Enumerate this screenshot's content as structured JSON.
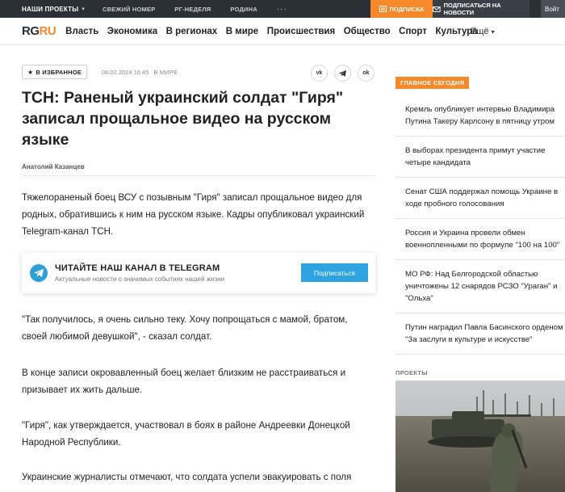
{
  "topbar": {
    "projects": "НАШИ ПРОЕКТЫ",
    "links": [
      "СВЕЖИЙ НОМЕР",
      "РГ-НЕДЕЛЯ",
      "РОДИНА"
    ],
    "more_dots": "···",
    "subscribe": "ПОДПИСКА",
    "news_subscribe": "ПОДПИСАТЬСЯ НА НОВОСТИ",
    "login": "Войт"
  },
  "navbar": {
    "logo_rg": "RG",
    "logo_ru": "RU",
    "items": [
      "Власть",
      "Экономика",
      "В регионах",
      "В мире",
      "Происшествия",
      "Общество",
      "Спорт",
      "Культура"
    ],
    "more": "Ещё"
  },
  "article": {
    "favorite": "В ИЗБРАННОЕ",
    "date": "08.02.2024 16:45",
    "rubric": "В МИРЕ",
    "share": [
      "vk",
      "tg",
      "ok"
    ],
    "title": "ТСН: Раненый украинский солдат \"Гиря\" записал прощальное видео на русском языке",
    "author": "Анатолий Казанцев",
    "lead": "Тяжелораненый боец ВСУ с позывным \"Гиря\" записал прощальное видео для родных, обратившись к ним на русском языке. Кадры опубликовал украинский Telegram-канал ТСН.",
    "paragraphs": [
      "\"Так получилось, я очень сильно теку. Хочу попрощаться с мамой, братом, своей любимой девушкой\", - сказал солдат.",
      "В конце записи окровавленный боец желает близким не расстраиваться и призывает их жить дальше.",
      "\"Гиря\", как утверждается, участвовал в боях в районе Андреевки Донецкой Народной Республики.",
      "Украинские журналисты отмечают, что солдата успели эвакуировать с поля"
    ]
  },
  "telegram": {
    "title": "ЧИТАЙТЕ НАШ КАНАЛ В TELEGRAM",
    "subtitle": "Актуальные новости о значимых событиях нашей жизни",
    "button": "Подписаться"
  },
  "sidebar": {
    "header": "ГЛАВНОЕ СЕГОДНЯ",
    "items": [
      "Кремль опубликует интервью Владимира Путина Такеру Карлсону в пятницу утром",
      "В выборах президента примут участие четыре кандидата",
      "Сенат США поддержал помощь Украине в ходе пробного голосования",
      "Россия и Украина провели обмен военнопленными по формуле \"100 на 100\"",
      "МО РФ: Над Белгородской областью уничтожены 12 снарядов РСЗО \"Ураган\" и \"Ольха\"",
      "Путин наградил Павла Басинского орденом \"За заслуги в культуре и искусстве\""
    ],
    "projects": "ПРОЕКТЫ"
  },
  "colors": {
    "accent": "#f5892b",
    "dark": "#2b2f36",
    "telegram": "#2fa3e0"
  }
}
